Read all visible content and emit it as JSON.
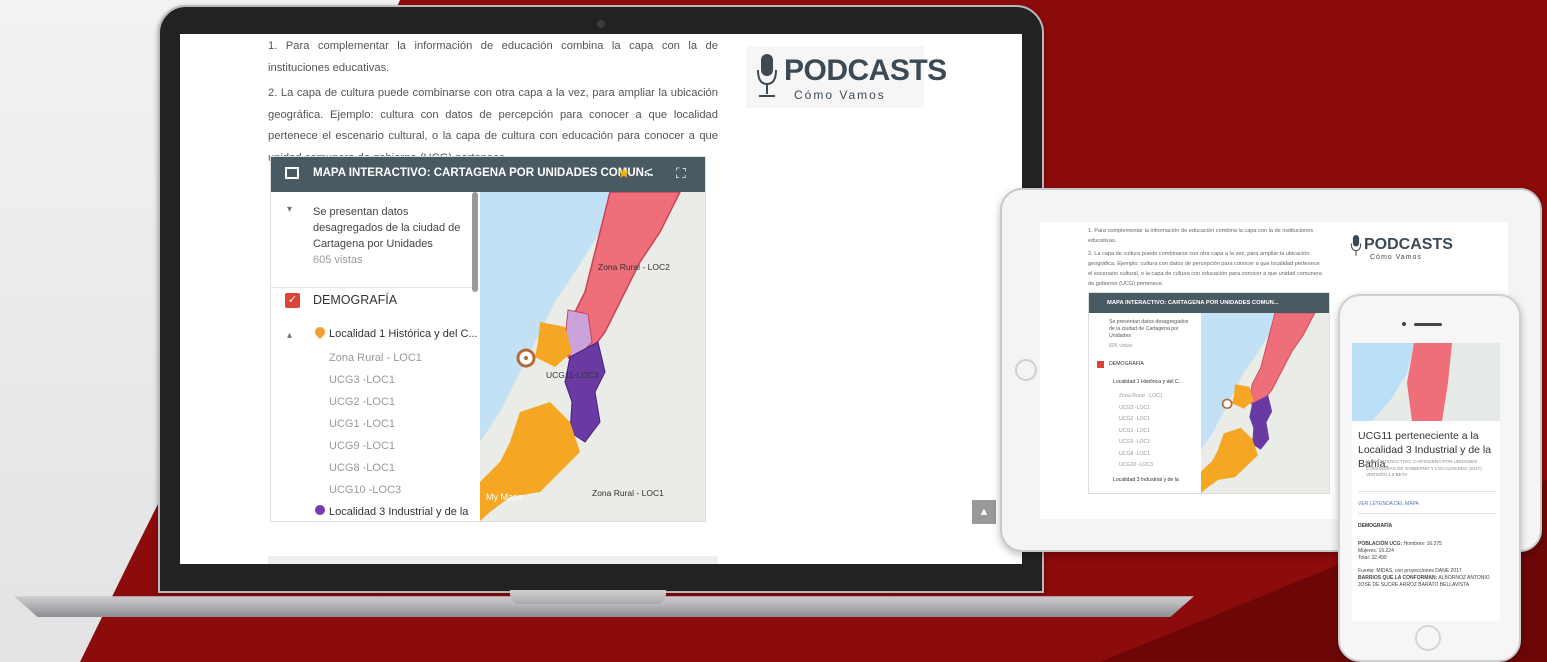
{
  "article": {
    "para1": "1. Para complementar la información de educación combina la capa con la de instituciones educativas.",
    "para2": "2. La capa de cultura puede combinarse con otra capa a la vez, para ampliar la ubicación geográfica. Ejemplo: cultura con datos de percepción para conocer a que localidad pertenece el escenario cultural, o la capa de cultura con educación para conocer a que unidad comunera de gobierno (UCG) pertenece."
  },
  "podcast": {
    "title": "PODCASTS",
    "subtitle": "Cómo Vamos"
  },
  "map": {
    "title": "MAPA INTERACTIVO: CARTAGENA POR UNIDADES COMUN...",
    "description": "Se presentan datos desagregados de la ciudad de Cartagena por Unidades",
    "views": "605 vistas",
    "layer_name": "DEMOGRAFÍA",
    "group1": "Localidad 1 Histórica y del C...",
    "items": [
      "Zona Rural - LOC1",
      "UCG3 -LOC1",
      "UCG2 -LOC1",
      "UCG1 -LOC1",
      "UCG9 -LOC1",
      "UCG8 -LOC1",
      "UCG10 -LOC3"
    ],
    "group2": "Localidad 3 Industrial y de la",
    "canvas_labels": {
      "zona_rural": "Zona Rural - LOC2",
      "ucg11": "UCG11-LOC3",
      "zona_rural3": "Zona Rural - LOC1",
      "brand": "My Maps"
    }
  },
  "tablet": {
    "para1": "1. Para complementar la información de educación combina la capa con la de instituciones educativas.",
    "para2": "2. La capa de cultura puede combinarse con otra capa a la vez, para ampliar la ubicación geográfica. Ejemplo: cultura con datos de percepción para conocer a que localidad pertenece el escenario cultural, o la capa de cultura con educación para conocer a que unidad comunera de gobierno (UCG) pertenece.",
    "map_title": "MAPA INTERACTIVO: CARTAGENA POR UNIDADES COMUN...",
    "description": "Se presentan datos desagregados de la ciudad de Cartagena por Unidades",
    "views": "605 vistas",
    "layer_name": "DEMOGRAFÍA",
    "group1": "Localidad 1 Histórica y del C...",
    "items": [
      "Zona Rural - LOC1",
      "UCG3 -LOC1",
      "UCG2 -LOC1",
      "UCG1 -LOC1",
      "UCG9 -LOC1",
      "UCG8 -LOC1",
      "UCG10 -LOC3"
    ],
    "group2": "Localidad 3 Industrial y de la"
  },
  "phone": {
    "title": "UCG11 perteneciente a la Localidad 3 Industrial y de la Bahía.",
    "subtitle": "MAPA INTERACTIVO: CARTAGENA POR UNIDADES COMUNERAS DE GOBIERNO Y LOCALIDADES (2017) VERSIÓN 1.0 BETA",
    "legend_link": "VER LEYENDA DEL MAPA",
    "section": "DEMOGRAFÍA",
    "poblacion_label": "POBLACIÓN UCG:",
    "poblacion": "Hombres: 16.275",
    "mujeres": "Mujeres: 16.224",
    "total": "Total: 32.499",
    "fuente": "Fuente: MIDAS, con proyecciones DANE 2017",
    "barrios_label": "BARRIOS QUE LA CONFORMAN:",
    "barrios": "ALBORNOZ ANTONIO JOSE DE SUCRE ARROZ BARATO BELLAVISTA"
  },
  "colors": {
    "red_bg": "#8c0b0b",
    "map_header": "#4a5a63",
    "pink": "#ee6e7a",
    "orange": "#f5a623",
    "purple": "#6a3aa3"
  }
}
